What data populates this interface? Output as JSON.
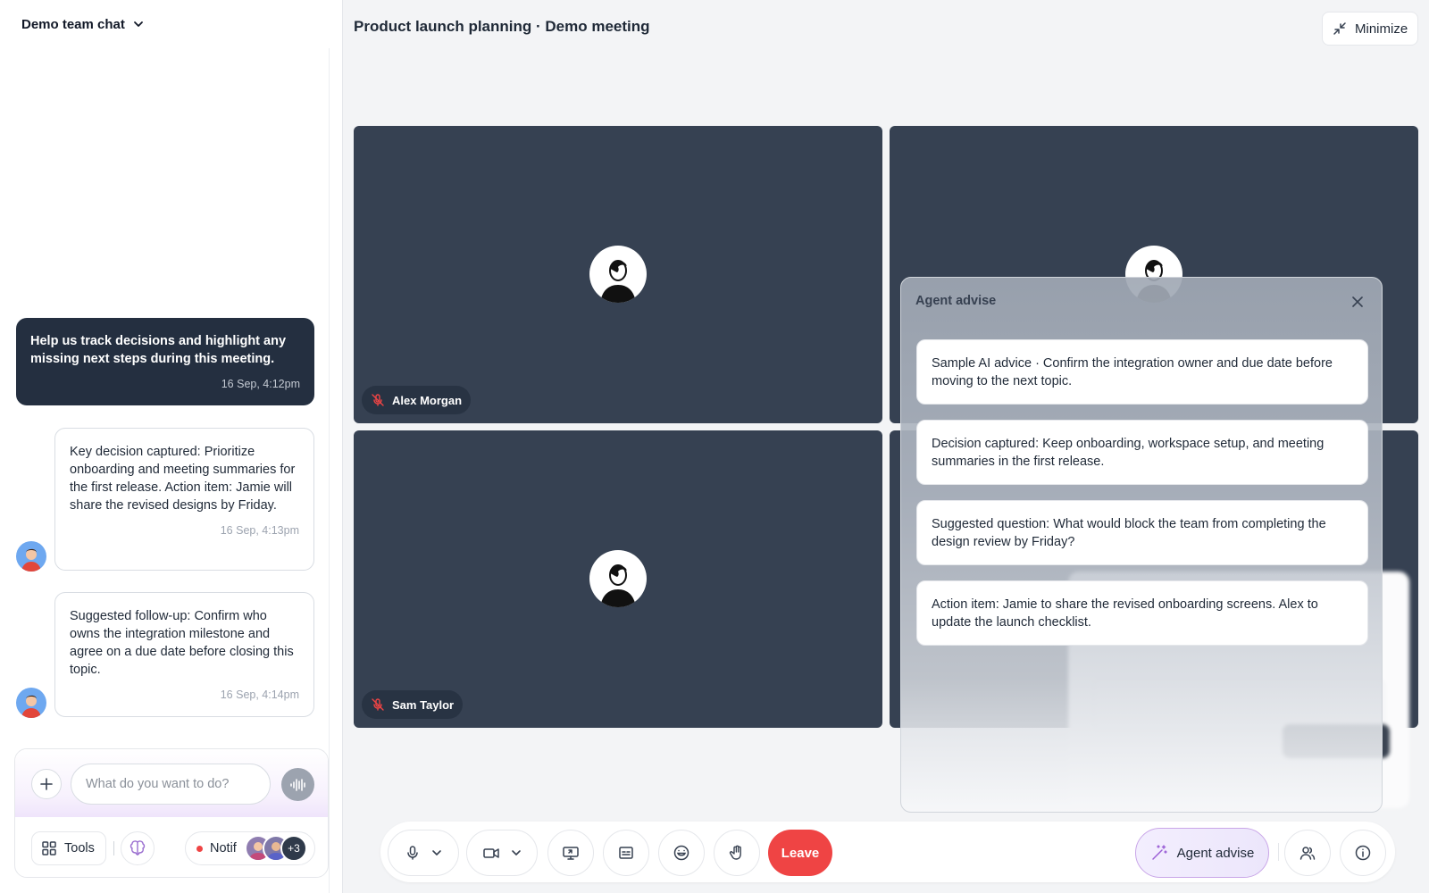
{
  "chat": {
    "title": "Demo team chat",
    "messages": [
      {
        "role": "user",
        "text": "Help us track decisions and highlight any missing next steps during this meeting.",
        "time": "16 Sep, 4:12pm"
      },
      {
        "role": "agent",
        "text": "Key decision captured: Prioritize onboarding and meeting summaries for the first release. Action item: Jamie will share the revised designs by Friday.",
        "time": "16 Sep, 4:13pm"
      },
      {
        "role": "agent",
        "text": "Suggested follow-up: Confirm who owns the integration milestone and agree on a due date before closing this topic.",
        "time": "16 Sep, 4:14pm"
      }
    ],
    "composer": {
      "placeholder": "What do you want to do?",
      "tools_label": "Tools",
      "notif_label": "Notif",
      "more_count": "+3"
    }
  },
  "meeting": {
    "title": "Product launch planning · Demo meeting",
    "minimize_label": "Minimize",
    "participants": [
      {
        "name": "Alex Morgan",
        "muted": true
      },
      {
        "name": "",
        "muted": true
      },
      {
        "name": "Sam Taylor",
        "muted": true
      },
      {
        "name": "",
        "muted": true
      }
    ]
  },
  "agent_panel": {
    "title": "Agent advise",
    "items": [
      "Sample AI advice · Confirm the integration owner and due date before moving to the next topic.",
      "Decision captured: Keep onboarding, workspace setup, and meeting summaries in the first release.",
      "Suggested question: What would block the team from completing the design review by Friday?",
      "Action item: Jamie to share the revised onboarding screens. Alex to update the launch checklist."
    ]
  },
  "toolbar": {
    "leave_label": "Leave",
    "agent_label": "Agent advise"
  },
  "colors": {
    "tile_bg": "#364152",
    "user_bubble": "#242f40",
    "leave": "#ef4444",
    "agent_accent": "#c9a6e8"
  }
}
